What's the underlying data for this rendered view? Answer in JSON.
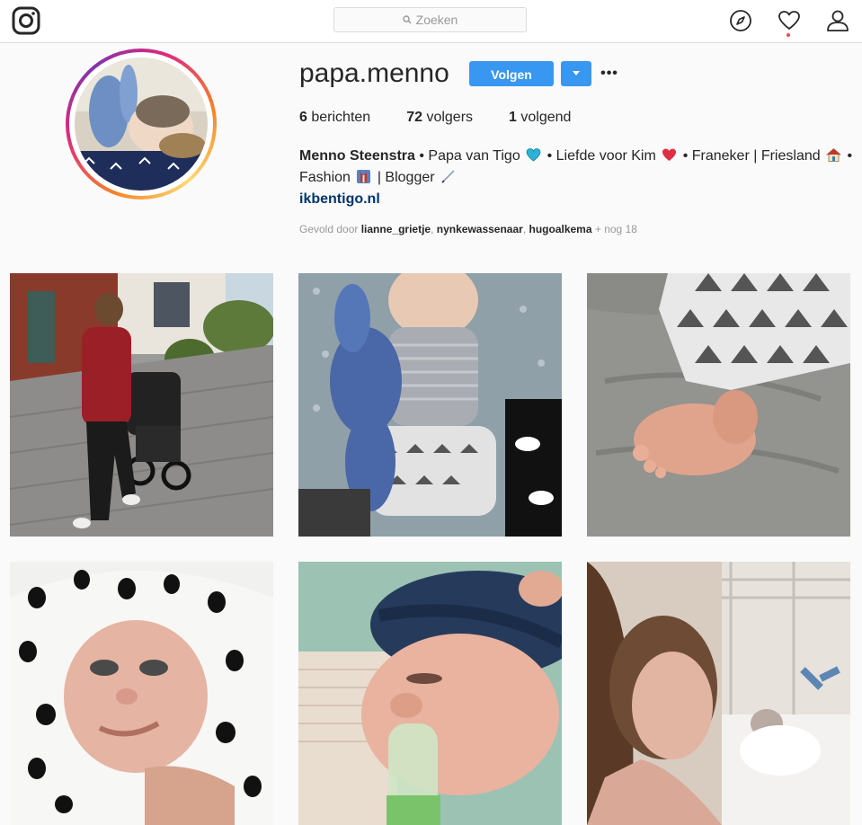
{
  "nav": {
    "search_placeholder": "Zoeken",
    "icons": [
      "instagram-logo-icon",
      "search-icon",
      "compass-icon",
      "heart-icon",
      "user-icon"
    ]
  },
  "profile": {
    "username": "papa.menno",
    "follow_label": "Volgen",
    "more_label": "•••",
    "stats": [
      {
        "count": "6",
        "label": "berichten"
      },
      {
        "count": "72",
        "label": "volgers"
      },
      {
        "count": "1",
        "label": "volgend"
      }
    ],
    "bio": {
      "name": "Menno Steenstra",
      "part1": " • Papa van Tigo ",
      "part2": " • Liefde voor Kim ",
      "part3": " • Franeker | Friesland ",
      "part4": " •",
      "part5": "Fashion ",
      "part6": " | Blogger ",
      "emojis": [
        "blue-heart-icon",
        "red-heart-icon",
        "house-icon",
        "suit-icon",
        "pen-icon"
      ]
    },
    "website": "ikbentigo.nl",
    "followed_by": {
      "prefix": "Gevold door ",
      "users": [
        "lianne_grietje",
        "nynkewassenaar",
        "hugoalkema"
      ],
      "suffix": " + nog 18"
    }
  },
  "posts": [
    {
      "subject": "woman pushing stroller"
    },
    {
      "subject": "baby with blue bunny"
    },
    {
      "subject": "baby foot"
    },
    {
      "subject": "baby in polka-dot blanket"
    },
    {
      "subject": "baby with bottle"
    },
    {
      "subject": "mother and baby in hospital"
    }
  ],
  "colors": {
    "accent": "#3897f0",
    "link": "#003569",
    "notification": "#ed4956"
  }
}
